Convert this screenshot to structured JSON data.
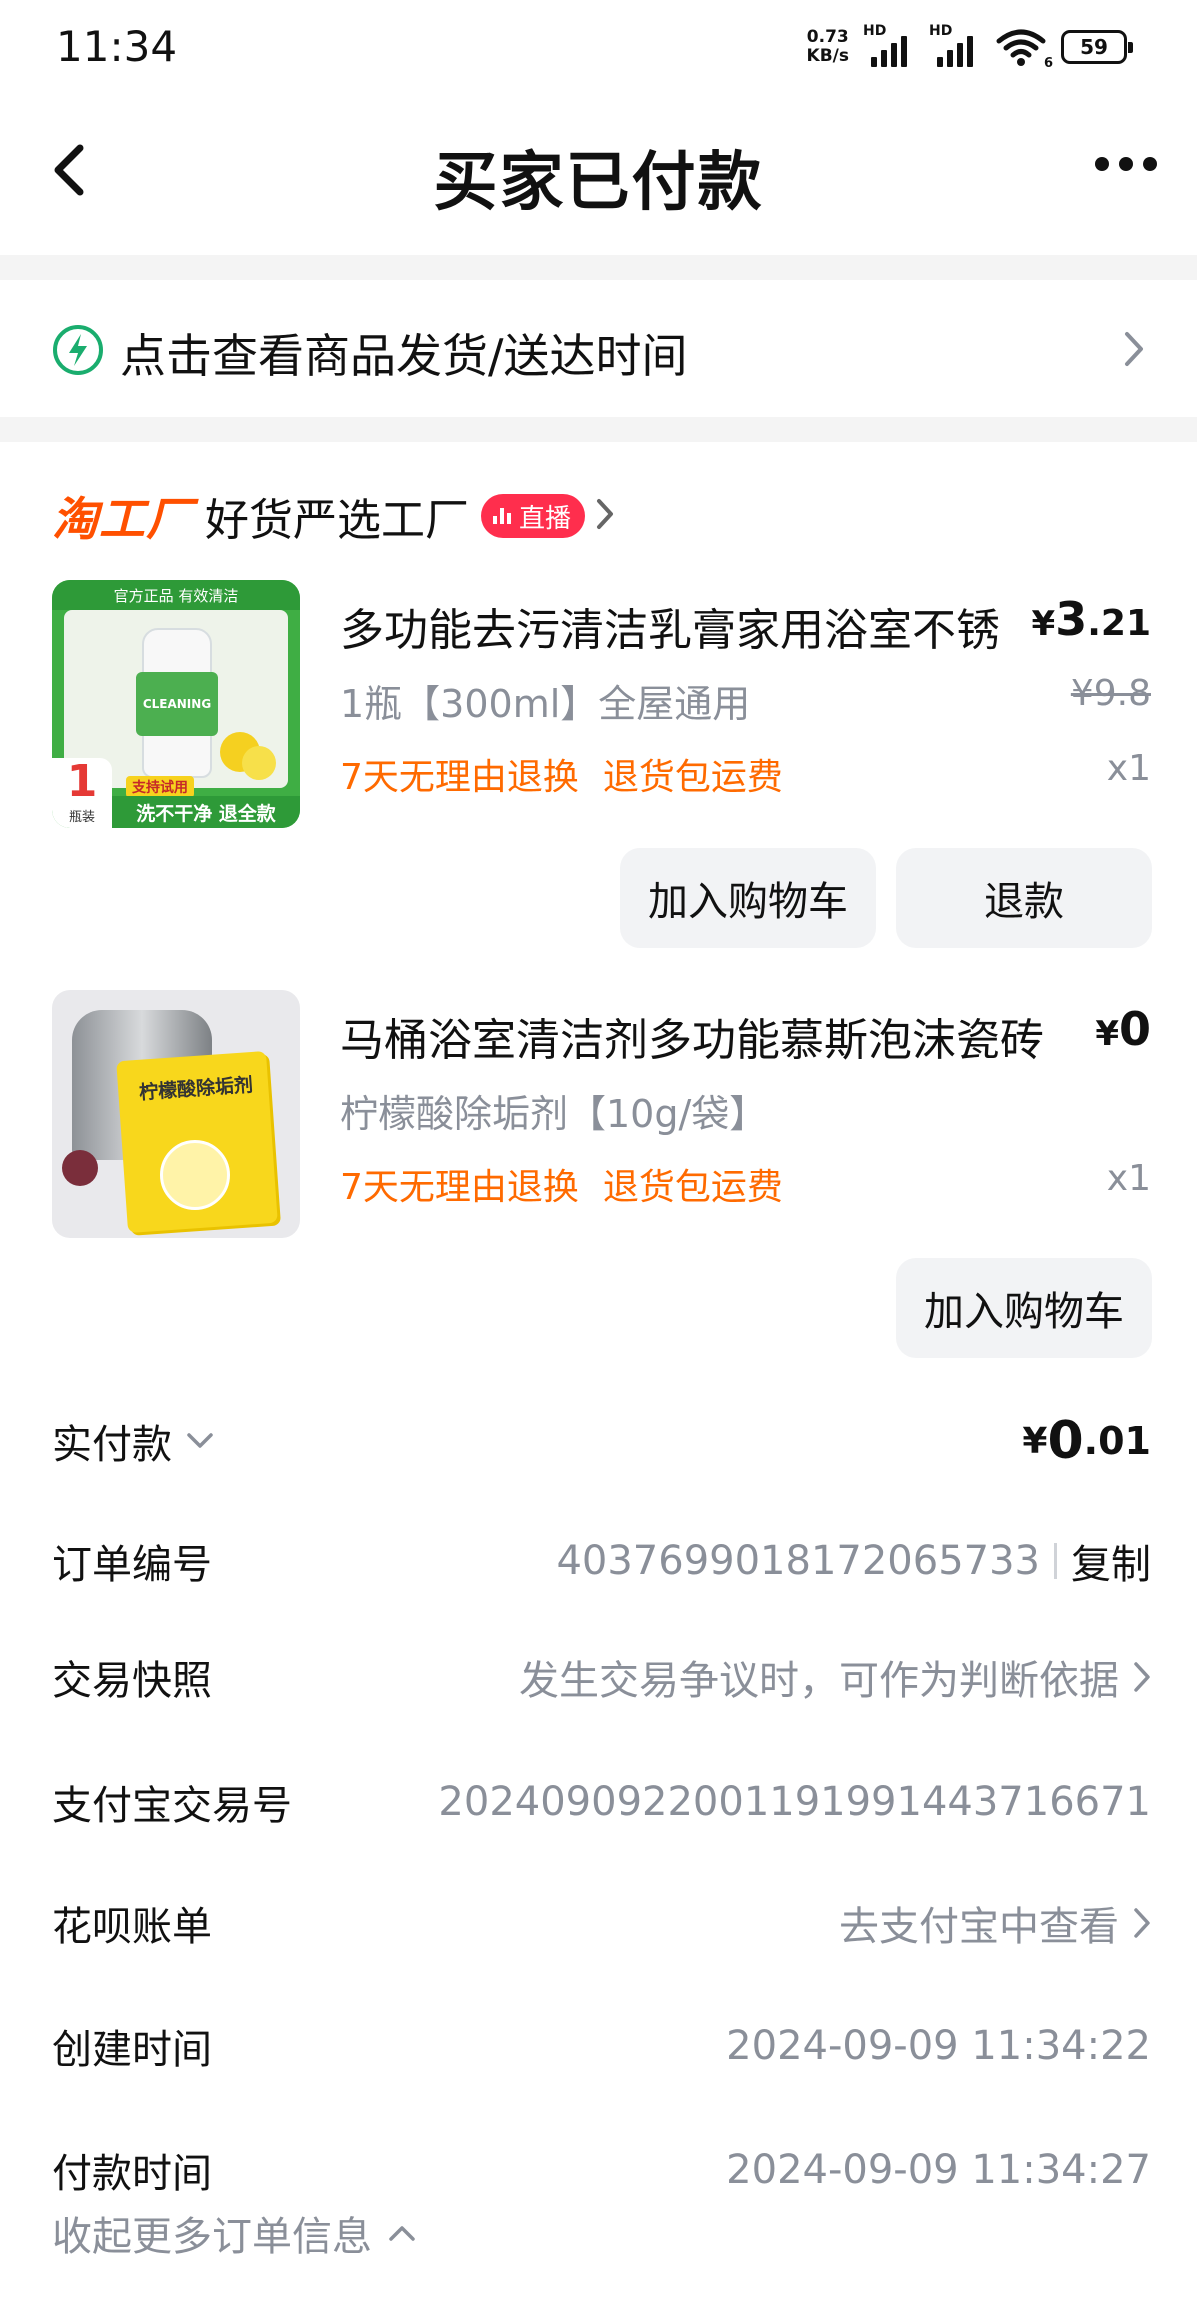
{
  "status_bar": {
    "time": "11:34",
    "net_speed_value": "0.73",
    "net_speed_unit": "KB/s",
    "signal1_label": "HD",
    "signal2_label": "HD",
    "wifi_sub": "6",
    "battery": "59"
  },
  "nav": {
    "title": "买家已付款"
  },
  "delivery": {
    "text": "点击查看商品发货/送达时间"
  },
  "shop": {
    "brand": "淘工厂",
    "name": "好货严选工厂",
    "live_badge": "直播"
  },
  "items": [
    {
      "title": "多功能去污清洁乳膏家用浴室不锈",
      "price_symbol": "¥",
      "price_int": "3",
      "price_dec": ".21",
      "sku": "1瓶【300ml】全屋通用",
      "original_price": "¥9.8",
      "tags": [
        "7天无理由退换",
        "退货包运费"
      ],
      "qty": "x1",
      "buttons": [
        "加入购物车",
        "退款"
      ],
      "thumb_texts": {
        "top": "官方正品 有效清洁",
        "bottle": "CLEANING",
        "badge_num": "1",
        "badge_unit": "瓶装",
        "trial": "支持试用",
        "bottom": "洗不干净 退全款"
      }
    },
    {
      "title": "马桶浴室清洁剂多功能慕斯泡沫瓷砖",
      "price_symbol": "¥",
      "price_int": "0",
      "sku": "柠檬酸除垢剂【10g/袋】",
      "tags": [
        "7天无理由退换",
        "退货包运费"
      ],
      "qty": "x1",
      "buttons": [
        "加入购物车"
      ],
      "thumb_texts": {
        "pack": "柠檬酸除垢剂"
      }
    }
  ],
  "info": {
    "paid_label": "实付款",
    "paid_symbol": "¥",
    "paid_int": "0",
    "paid_dec": ".01",
    "order_no_label": "订单编号",
    "order_no": "4037699018172065733",
    "copy": "复制",
    "snapshot_label": "交易快照",
    "snapshot_value": "发生交易争议时，可作为判断依据",
    "alipay_label": "支付宝交易号",
    "alipay_no": "2024090922001191991443716671",
    "huabei_label": "花呗账单",
    "huabei_value": "去支付宝中查看",
    "created_label": "创建时间",
    "created_value": "2024-09-09 11:34:22",
    "paytime_label": "付款时间",
    "paytime_value": "2024-09-09 11:34:27",
    "collapse": "收起更多订单信息"
  },
  "colors": {
    "accent_orange": "#ff6a00",
    "brand_orange": "#ff5000",
    "live_red": "#ff2e4d",
    "muted_gray": "#8a8f99",
    "delivery_icon_green": "#1aad6e"
  }
}
